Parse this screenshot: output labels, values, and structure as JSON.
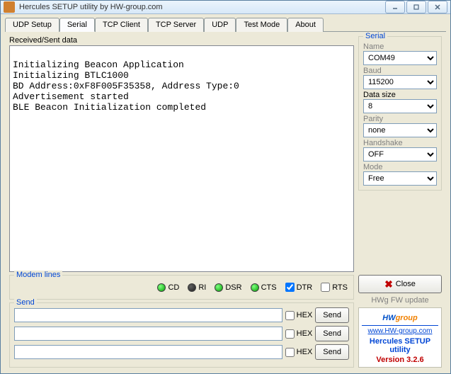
{
  "title": "Hercules SETUP utility by HW-group.com",
  "tabs": [
    "UDP Setup",
    "Serial",
    "TCP Client",
    "TCP Server",
    "UDP",
    "Test Mode",
    "About"
  ],
  "activeTab": 1,
  "receivedLabel": "Received/Sent data",
  "terminal": "\nInitializing Beacon Application\nInitializing BTLC1000\nBD Address:0xF8F005F35358, Address Type:0\nAdvertisement started\nBLE Beacon Initialization completed",
  "modem": {
    "legend": "Modem lines",
    "leds": [
      {
        "name": "CD",
        "on": true
      },
      {
        "name": "RI",
        "on": false
      },
      {
        "name": "DSR",
        "on": true
      },
      {
        "name": "CTS",
        "on": true
      }
    ],
    "checks": [
      {
        "name": "DTR",
        "checked": true
      },
      {
        "name": "RTS",
        "checked": false
      }
    ]
  },
  "send": {
    "legend": "Send",
    "hexLabel": "HEX",
    "sendLabel": "Send",
    "rows": [
      {
        "value": "",
        "hex": false
      },
      {
        "value": "",
        "hex": false
      },
      {
        "value": "",
        "hex": false
      }
    ]
  },
  "serial": {
    "legend": "Serial",
    "fields": [
      {
        "label": "Name",
        "value": "COM49",
        "dim": true
      },
      {
        "label": "Baud",
        "value": "115200",
        "dim": true
      },
      {
        "label": "Data size",
        "value": "8",
        "dim": false
      },
      {
        "label": "Parity",
        "value": "none",
        "dim": true
      },
      {
        "label": "Handshake",
        "value": "OFF",
        "dim": true
      },
      {
        "label": "Mode",
        "value": "Free",
        "dim": true
      }
    ]
  },
  "closeLabel": "Close",
  "fwLink": "HWg FW update",
  "logo": {
    "hw": "HW",
    "group": "group",
    "url": "www.HW-group.com",
    "product": "Hercules SETUP utility",
    "version": "Version 3.2.6"
  }
}
